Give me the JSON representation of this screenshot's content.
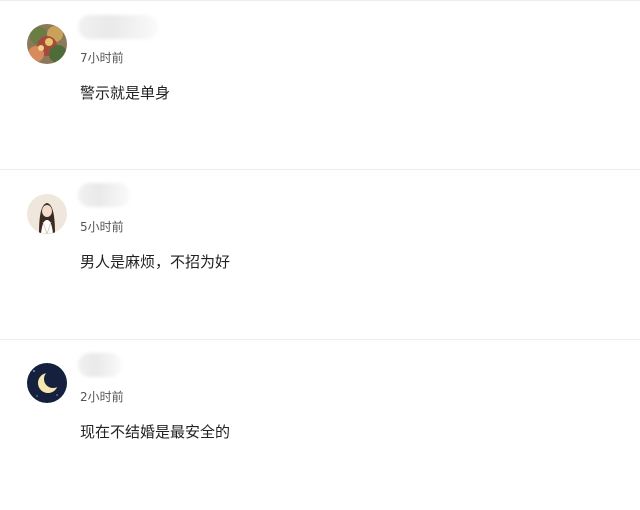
{
  "comments": [
    {
      "time": "7小时前",
      "text": "警示就是单身",
      "avatar": "floral-avatar-icon",
      "username": ""
    },
    {
      "time": "5小时前",
      "text": "男人是麻烦，不招为好",
      "avatar": "girl-portrait-avatar-icon",
      "username": ""
    },
    {
      "time": "2小时前",
      "text": "现在不结婚是最安全的",
      "avatar": "crescent-moon-avatar-icon",
      "username": ""
    }
  ],
  "colors": {
    "background": "#ffffff",
    "divider": "#ececec",
    "time_text": "#555555",
    "comment_text": "#222222"
  }
}
